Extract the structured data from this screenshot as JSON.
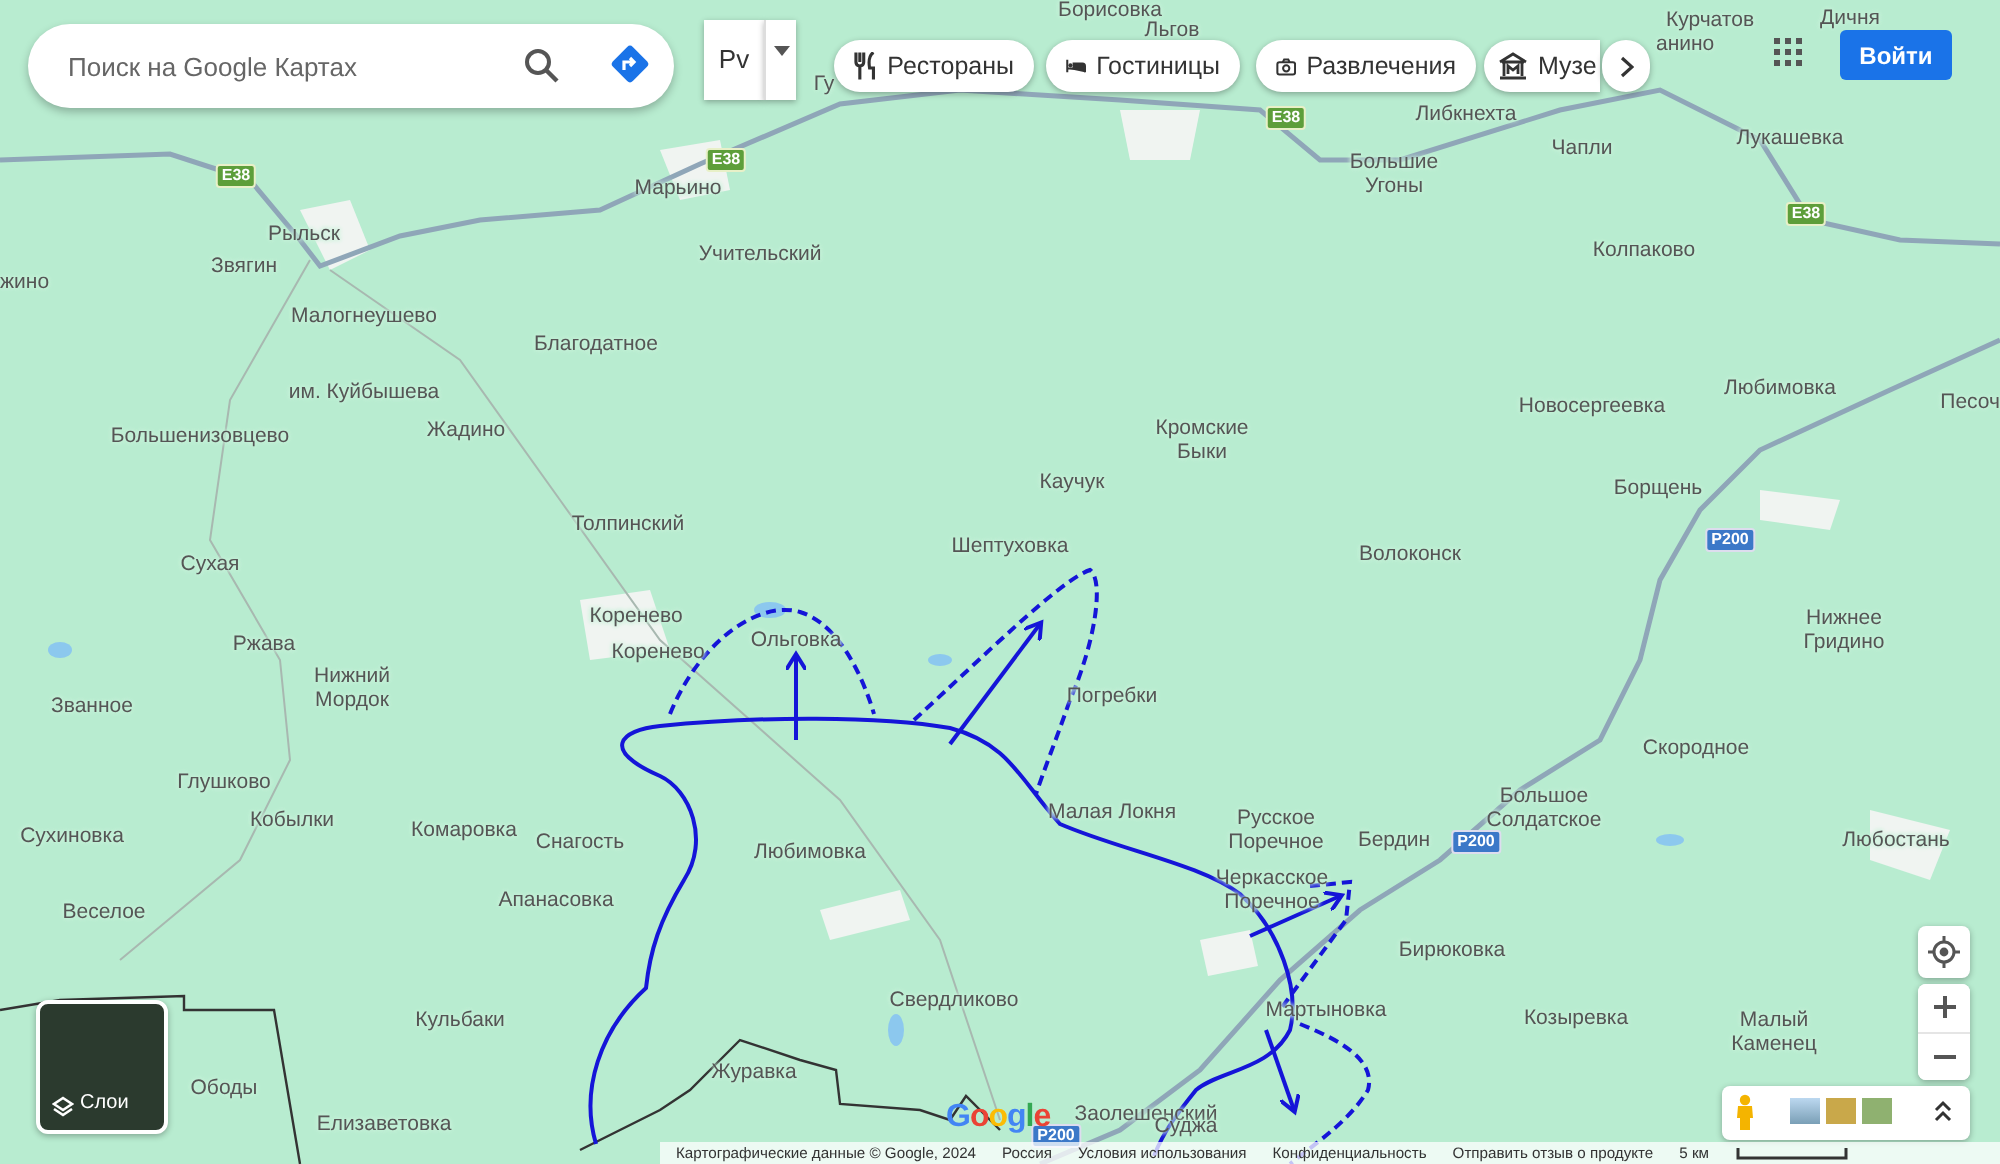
{
  "search": {
    "placeholder": "Поиск на Google Картах"
  },
  "language_button": {
    "label": "Рv"
  },
  "chips": [
    {
      "label": "Рестораны",
      "kind": "restaurants"
    },
    {
      "label": "Гостиницы",
      "kind": "hotels"
    },
    {
      "label": "Развлечения",
      "kind": "entertainment"
    },
    {
      "label": "Музе",
      "kind": "museums"
    }
  ],
  "sign_in": {
    "label": "Войти"
  },
  "places": [
    {
      "lines": [
        "Гу"
      ]
    },
    {
      "lines": [
        "Марьино"
      ]
    },
    {
      "lines": [
        "Учительский"
      ]
    },
    {
      "lines": [
        "Рыльск"
      ]
    },
    {
      "lines": [
        "Звягин"
      ]
    },
    {
      "lines": [
        "жино"
      ]
    },
    {
      "lines": [
        "Малогнеушево"
      ]
    },
    {
      "lines": [
        "Благодатное"
      ]
    },
    {
      "lines": [
        "им. Куйбышева"
      ]
    },
    {
      "lines": [
        "Большенизовцево"
      ]
    },
    {
      "lines": [
        "Жадино"
      ]
    },
    {
      "lines": [
        "Толпинский"
      ]
    },
    {
      "lines": [
        "Сухая"
      ]
    },
    {
      "lines": [
        "Коренево"
      ]
    },
    {
      "lines": [
        "Ржава"
      ]
    },
    {
      "lines": [
        "Коренево"
      ]
    },
    {
      "lines": [
        "Ольговка"
      ]
    },
    {
      "lines": [
        "Званное"
      ]
    },
    {
      "lines": [
        "Нижний",
        "Мордок"
      ]
    },
    {
      "lines": [
        "Глушково"
      ]
    },
    {
      "lines": [
        "Сухиновка"
      ]
    },
    {
      "lines": [
        "Кобылки"
      ]
    },
    {
      "lines": [
        "Комаровка"
      ]
    },
    {
      "lines": [
        "Снагость"
      ]
    },
    {
      "lines": [
        "Любимовка"
      ]
    },
    {
      "lines": [
        "Апанасовка"
      ]
    },
    {
      "lines": [
        "Веселое"
      ]
    },
    {
      "lines": [
        "Кульбаки"
      ]
    },
    {
      "lines": [
        "Свердликово"
      ]
    },
    {
      "lines": [
        "Ободы"
      ]
    },
    {
      "lines": [
        "Журавка"
      ]
    },
    {
      "lines": [
        "Елизаветовка"
      ]
    },
    {
      "lines": [
        "Шептуховка"
      ]
    },
    {
      "lines": [
        "Каучук"
      ]
    },
    {
      "lines": [
        "Кромские",
        "Быки"
      ]
    },
    {
      "lines": [
        "Погребки"
      ]
    },
    {
      "lines": [
        "Малая Локня"
      ]
    },
    {
      "lines": [
        "Русское",
        "Поречное"
      ]
    },
    {
      "lines": [
        "Бердин"
      ]
    },
    {
      "lines": [
        "Черкасское",
        "Поречное"
      ]
    },
    {
      "lines": [
        "Мартыновка"
      ]
    },
    {
      "lines": [
        "Заолешенский"
      ]
    },
    {
      "lines": [
        "Суджа"
      ]
    },
    {
      "lines": [
        "Борисовка"
      ]
    },
    {
      "lines": [
        "Льгов"
      ]
    },
    {
      "lines": [
        "Курчатов"
      ]
    },
    {
      "lines": [
        "Дичня"
      ]
    },
    {
      "lines": [
        "анино"
      ]
    },
    {
      "lines": [
        "Либкнехта"
      ]
    },
    {
      "lines": [
        "Большие",
        "Угоны"
      ]
    },
    {
      "lines": [
        "Чапли"
      ]
    },
    {
      "lines": [
        "Лукашевка"
      ]
    },
    {
      "lines": [
        "Колпаково"
      ]
    },
    {
      "lines": [
        "Новосергеевка"
      ]
    },
    {
      "lines": [
        "Любимовка"
      ]
    },
    {
      "lines": [
        "Песоч"
      ]
    },
    {
      "lines": [
        "Борщень"
      ]
    },
    {
      "lines": [
        "Волоконск"
      ]
    },
    {
      "lines": [
        "Нижнее",
        "Гридино"
      ]
    },
    {
      "lines": [
        "Скородное"
      ]
    },
    {
      "lines": [
        "Большое",
        "Солдатское"
      ]
    },
    {
      "lines": [
        "Любостань"
      ]
    },
    {
      "lines": [
        "Бирюковка"
      ]
    },
    {
      "lines": [
        "Козыревка"
      ]
    },
    {
      "lines": [
        "Малый",
        "Каменец"
      ]
    }
  ],
  "road_shields": [
    {
      "label": "E38",
      "kind": "european"
    },
    {
      "label": "E38",
      "kind": "european"
    },
    {
      "label": "E38",
      "kind": "european"
    },
    {
      "label": "E38",
      "kind": "european"
    },
    {
      "label": "P200",
      "kind": "federal"
    },
    {
      "label": "P200",
      "kind": "federal"
    },
    {
      "label": "P200",
      "kind": "federal"
    }
  ],
  "layers_button": {
    "label": "Слои"
  },
  "logo": "Google",
  "footer": {
    "items": [
      "Картографические данные © Google, 2024",
      "Россия",
      "Условия использования",
      "Конфиденциальность",
      "Отправить отзыв о продукте"
    ],
    "scale": "5 км"
  }
}
